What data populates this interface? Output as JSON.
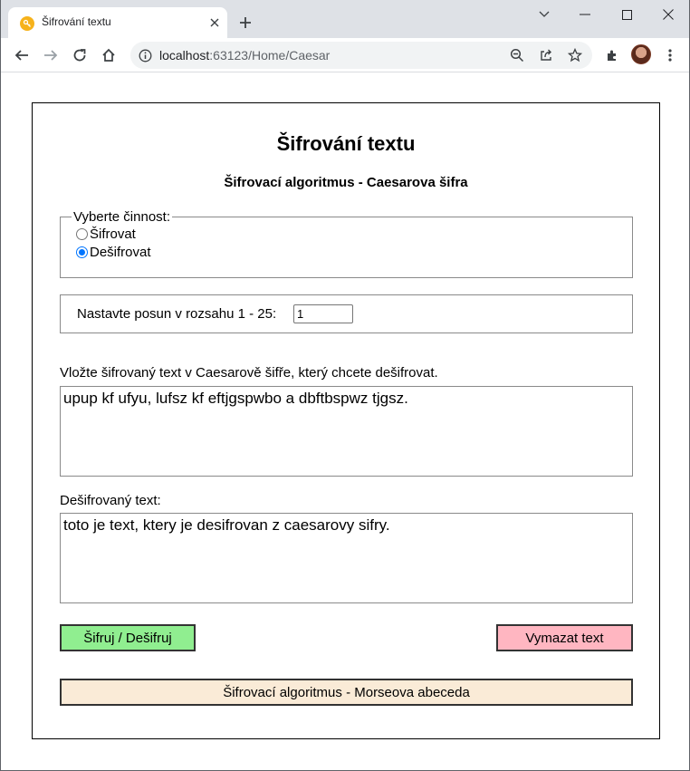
{
  "browser": {
    "tab_title": "Šifrování textu",
    "url_host": "localhost",
    "url_path": ":63123/Home/Caesar"
  },
  "page": {
    "title": "Šifrování textu",
    "subtitle": "Šifrovací algoritmus - Caesarova šifra",
    "mode": {
      "legend": "Vyberte činnost:",
      "options": [
        {
          "label": "Šifrovat",
          "checked": false
        },
        {
          "label": "Dešifrovat",
          "checked": true
        }
      ]
    },
    "shift": {
      "label": "Nastavte posun v rozsahu 1 - 25:",
      "value": "1"
    },
    "input": {
      "label": "Vložte šifrovaný text v Caesarově šifře, který chcete dešifrovat.",
      "value": "upup kf ufyu, lufsz kf eftjgspwbo a dbftbspwz tjgsz."
    },
    "output": {
      "label": "Dešifrovaný text:",
      "value": "toto je text, ktery je desifrovan z caesarovy sifry."
    },
    "buttons": {
      "encrypt": "Šifruj / Dešifruj",
      "clear": "Vymazat text",
      "morse": "Šifrovací algoritmus - Morseova abeceda"
    },
    "colors": {
      "encrypt_bg": "#90ee90",
      "clear_bg": "#ffb6c1",
      "morse_bg": "#faebd7",
      "radio_accent": "#0075ff"
    }
  }
}
